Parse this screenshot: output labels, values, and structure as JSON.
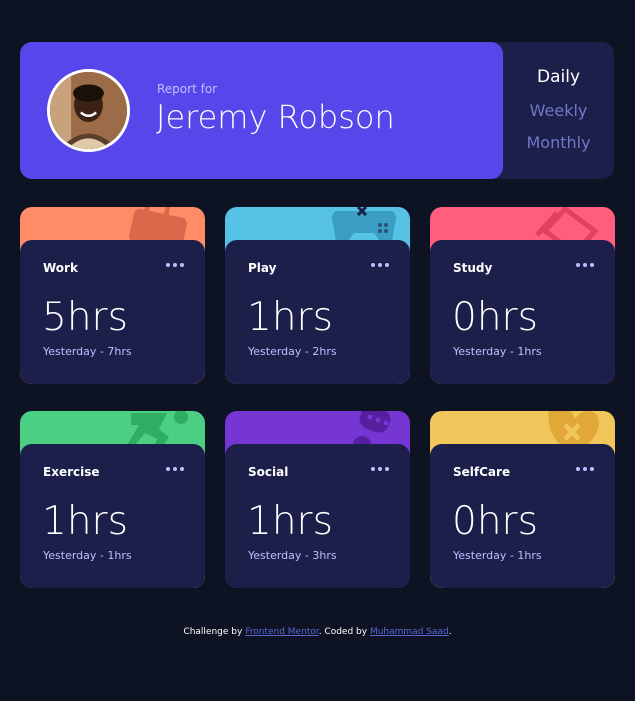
{
  "profile": {
    "report_for": "Report for",
    "name": "Jeremy Robson"
  },
  "periods": [
    {
      "label": "Daily",
      "active": true
    },
    {
      "label": "Weekly",
      "active": false
    },
    {
      "label": "Monthly",
      "active": false
    }
  ],
  "cards": [
    {
      "title": "Work",
      "current": "5hrs",
      "previous": "Yesterday - 7hrs",
      "color": "#ff8c66",
      "icon": "briefcase-icon"
    },
    {
      "title": "Play",
      "current": "1hrs",
      "previous": "Yesterday - 2hrs",
      "color": "#56c2e6",
      "icon": "gamepad-icon"
    },
    {
      "title": "Study",
      "current": "0hrs",
      "previous": "Yesterday - 1hrs",
      "color": "#ff5e7d",
      "icon": "books-icon"
    },
    {
      "title": "Exercise",
      "current": "1hrs",
      "previous": "Yesterday - 1hrs",
      "color": "#4bcf83",
      "icon": "runner-icon"
    },
    {
      "title": "Social",
      "current": "1hrs",
      "previous": "Yesterday - 3hrs",
      "color": "#7536d3",
      "icon": "chat-icon"
    },
    {
      "title": "SelfCare",
      "current": "0hrs",
      "previous": "Yesterday - 1hrs",
      "color": "#f1c65b",
      "icon": "heart-cross-icon"
    }
  ],
  "footer": {
    "challenge_by": "Challenge by",
    "frontend_mentor": "Frontend Mentor",
    "coded_by": ". Coded by",
    "author": "Muhammad Saad",
    "end": "."
  }
}
